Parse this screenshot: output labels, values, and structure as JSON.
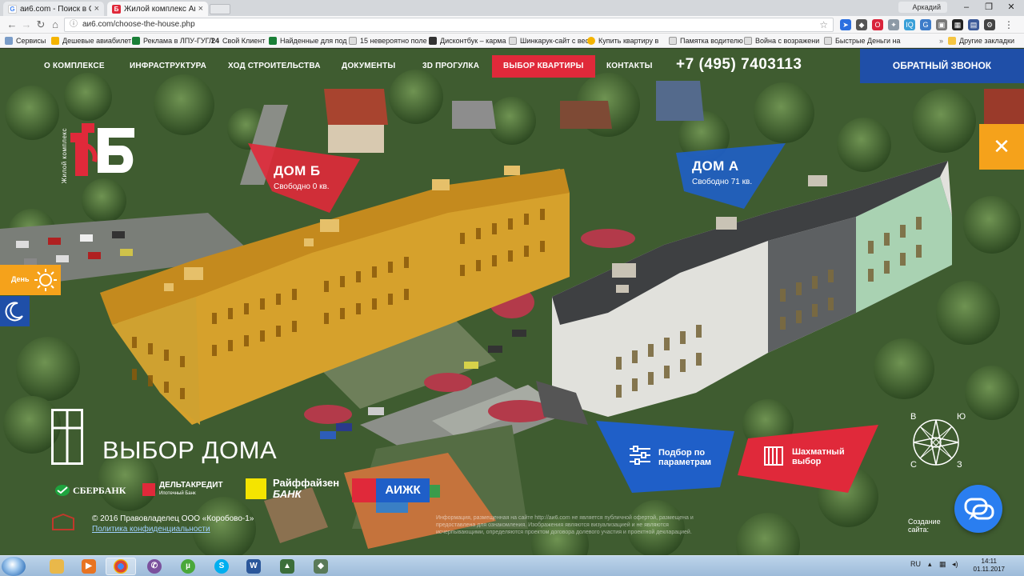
{
  "browser": {
    "tabs": [
      {
        "title": "аи6.com - Поиск в Goog",
        "favicon": "G",
        "color": "#4285f4"
      },
      {
        "title": "Жилой комплекс АиБ",
        "favicon": "Б",
        "color": "#e0293a"
      }
    ],
    "user": "Аркадий",
    "url": "аи6.com/choose-the-house.php",
    "bookmarks": [
      "Сервисы",
      "Дешевые авиабилет",
      "Реклама в ЛПУ-ГУГЛ",
      "Свой Клиент",
      "Найденные для под",
      "15 невероятно поле",
      "Дисконтбук – карма",
      "Шинкарук-сайт с вес",
      "Купить квартиру в",
      "Памятка водителю",
      "Война с возражени",
      "Быстрые Деньги на",
      "Другие закладки"
    ],
    "bookmark_24": "24"
  },
  "site": {
    "nav": [
      "О КОМПЛЕКСЕ",
      "ИНФРАСТРУКТУРА",
      "ХОД СТРОИТЕЛЬСТВА",
      "ДОКУМЕНТЫ",
      "3D ПРОГУЛКА",
      "ВЫБОР КВАРТИРЫ",
      "КОНТАКТЫ"
    ],
    "phone": "+7 (495) 7403113",
    "callback": "ОБРАТНЫЙ ЗВОНОК",
    "logo_caption": "Жилой комплекс",
    "close": "✕",
    "day_label": "День",
    "house_b": {
      "name": "ДОМ Б",
      "free": "Свободно 0 кв.",
      "color": "#e0293a"
    },
    "house_a": {
      "name": "ДОМ А",
      "free": "Свободно 71 кв.",
      "color": "#1f5fc8"
    },
    "choose_title": "ВЫБОР ДОМА",
    "params_line1": "Подбор по",
    "params_line2": "параметрам",
    "chess_line1": "Шахматный",
    "chess_line2": "выбор",
    "banks": {
      "sber": "СБЕРБАНК",
      "delta": "ДЕЛЬТАКРЕДИТ",
      "delta_sub": "Ипотечный Банк",
      "raif1": "Райффайзен",
      "raif2": "БАНК",
      "aijk": "АИЖК"
    },
    "copyright": "© 2016 Правовладелец ООО «Коробово-1»",
    "privacy": "Политика конфиденциальности",
    "disclaimer": "Информация, размещенная на сайте http://аи6.com не является публичной офертой, размещена и предоставлена для ознакомления. Изображения являются визуализацией и не являются исчерпывающими, определяются проектом договора долевого участия и проектной декларацией.",
    "created_line1": "Создание",
    "created_line2": "сайта:",
    "compass": {
      "n": "С",
      "s": "Ю",
      "w": "З",
      "e": "В"
    }
  },
  "taskbar": {
    "lang": "RU",
    "time": "14:11",
    "date": "01.11.2017"
  },
  "colors": {
    "accent_red": "#e0293a",
    "accent_blue": "#1f4fa8",
    "accent_orange": "#f5a21b"
  }
}
